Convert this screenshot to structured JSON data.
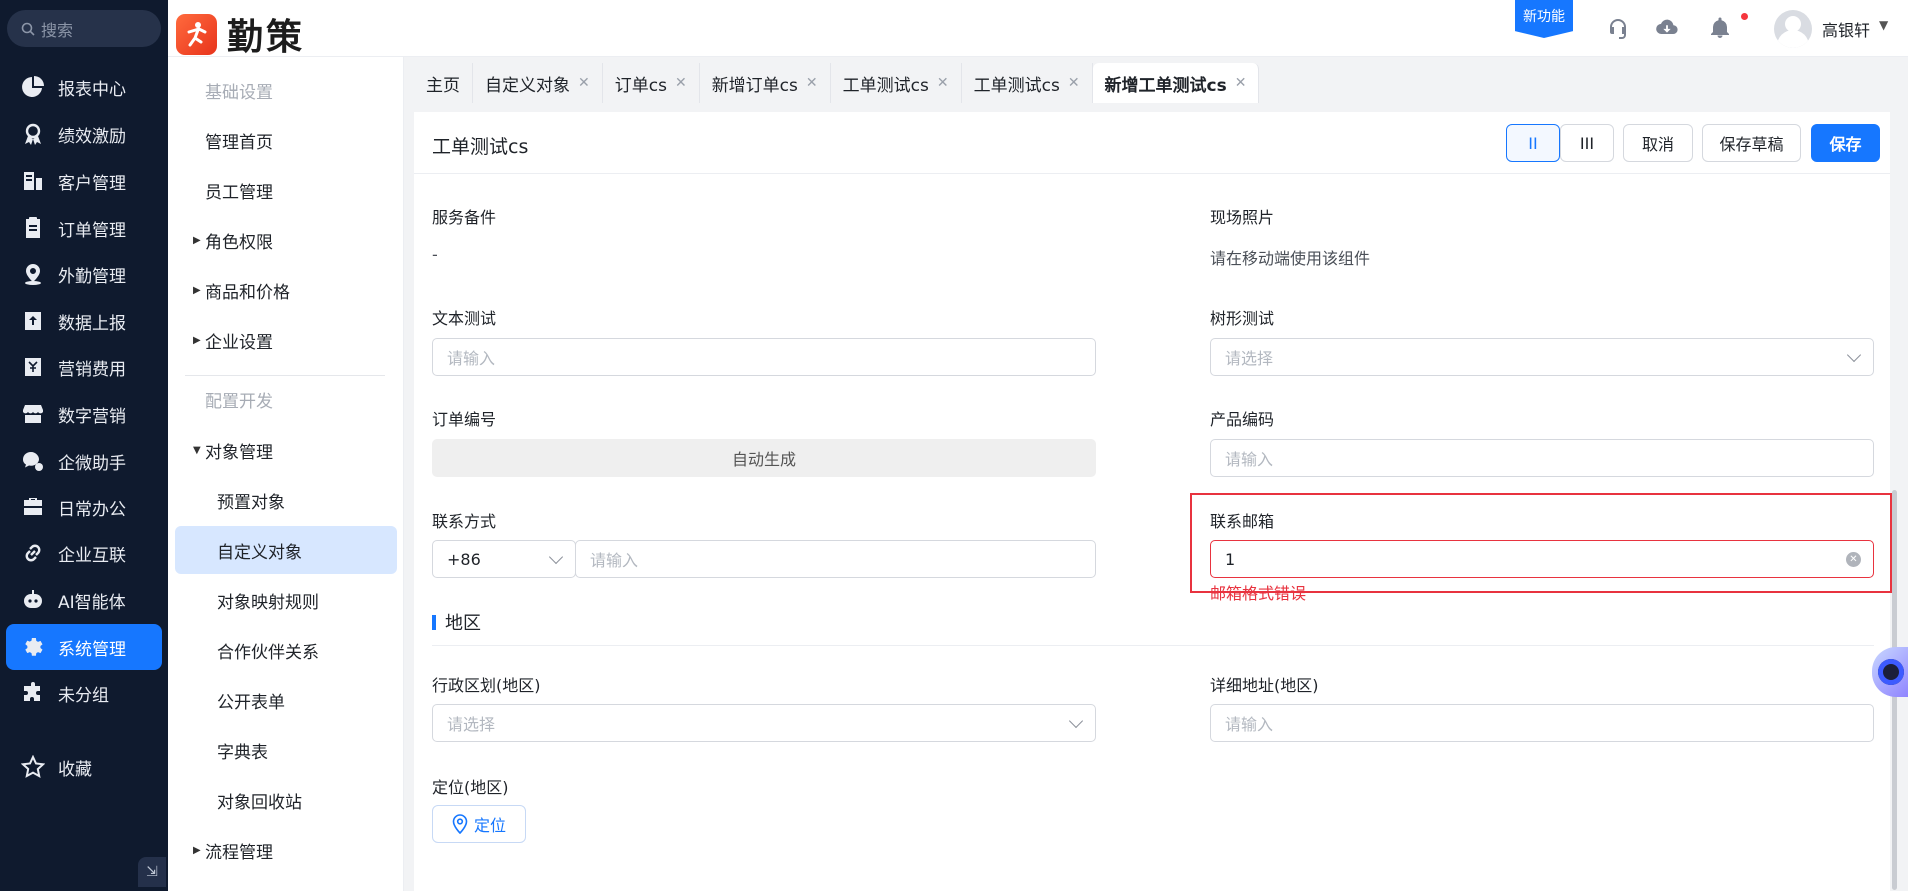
{
  "nav": {
    "search_placeholder": "搜索",
    "items": [
      {
        "label": "报表中心",
        "icon": "pie-chart-icon"
      },
      {
        "label": "绩效激励",
        "icon": "award-icon"
      },
      {
        "label": "客户管理",
        "icon": "customer-icon"
      },
      {
        "label": "订单管理",
        "icon": "order-icon"
      },
      {
        "label": "外勤管理",
        "icon": "location-icon"
      },
      {
        "label": "数据上报",
        "icon": "upload-icon"
      },
      {
        "label": "营销费用",
        "icon": "expense-icon"
      },
      {
        "label": "数字营销",
        "icon": "store-icon"
      },
      {
        "label": "企微助手",
        "icon": "wecom-icon"
      },
      {
        "label": "日常办公",
        "icon": "briefcase-icon"
      },
      {
        "label": "企业互联",
        "icon": "link-icon"
      },
      {
        "label": "AI智能体",
        "icon": "robot-icon"
      },
      {
        "label": "系统管理",
        "icon": "gear-icon"
      },
      {
        "label": "未分组",
        "icon": "puzzle-icon"
      },
      {
        "label": "收藏",
        "icon": "star-icon"
      }
    ],
    "active_index": 12
  },
  "topbar": {
    "brand": "勤策",
    "new_feature": "新功能",
    "username": "高银轩"
  },
  "submenu": {
    "items": [
      {
        "label": "基础设置",
        "kind": "section"
      },
      {
        "label": "管理首页",
        "kind": "item"
      },
      {
        "label": "员工管理",
        "kind": "item"
      },
      {
        "label": "角色权限",
        "kind": "group"
      },
      {
        "label": "商品和价格",
        "kind": "group"
      },
      {
        "label": "企业设置",
        "kind": "group"
      },
      {
        "label": "配置开发",
        "kind": "section"
      },
      {
        "label": "对象管理",
        "kind": "group-open"
      },
      {
        "label": "预置对象",
        "kind": "child"
      },
      {
        "label": "自定义对象",
        "kind": "child-active"
      },
      {
        "label": "对象映射规则",
        "kind": "child"
      },
      {
        "label": "合作伙伴关系",
        "kind": "child"
      },
      {
        "label": "公开表单",
        "kind": "child"
      },
      {
        "label": "字典表",
        "kind": "child"
      },
      {
        "label": "对象回收站",
        "kind": "child"
      },
      {
        "label": "流程管理",
        "kind": "group"
      }
    ]
  },
  "tabs": [
    {
      "label": "主页",
      "closable": false
    },
    {
      "label": "自定义对象",
      "closable": true
    },
    {
      "label": "订单cs",
      "closable": true
    },
    {
      "label": "新增订单cs",
      "closable": true
    },
    {
      "label": "工单测试cs",
      "closable": true
    },
    {
      "label": "工单测试cs",
      "closable": true
    },
    {
      "label": "新增工单测试cs",
      "closable": true,
      "active": true
    }
  ],
  "form": {
    "title": "工单测试cs",
    "buttons": {
      "layout_two": "II",
      "layout_three": "III",
      "cancel": "取消",
      "save_draft": "保存草稿",
      "save": "保存"
    },
    "service_remark": {
      "label": "服务备件",
      "value": "-"
    },
    "site_photo": {
      "label": "现场照片",
      "value": "请在移动端使用该组件"
    },
    "text_test": {
      "label": "文本测试",
      "placeholder": "请输入"
    },
    "tree_test": {
      "label": "树形测试",
      "placeholder": "请选择"
    },
    "order_no": {
      "label": "订单编号",
      "value": "自动生成"
    },
    "product_code": {
      "label": "产品编码",
      "placeholder": "请输入"
    },
    "contact": {
      "label": "联系方式",
      "country_code": "+86",
      "placeholder": "请输入"
    },
    "email": {
      "label": "联系邮箱",
      "value": "1",
      "error": "邮箱格式错误"
    },
    "region_section": "地区",
    "admin_region": {
      "label": "行政区划(地区)",
      "placeholder": "请选择"
    },
    "address": {
      "label": "详细地址(地区)",
      "placeholder": "请输入"
    },
    "location": {
      "label": "定位(地区)",
      "button": "定位"
    }
  },
  "colors": {
    "primary": "#1677ff",
    "nav_bg": "#0f1a2e",
    "error": "#e8333f"
  }
}
